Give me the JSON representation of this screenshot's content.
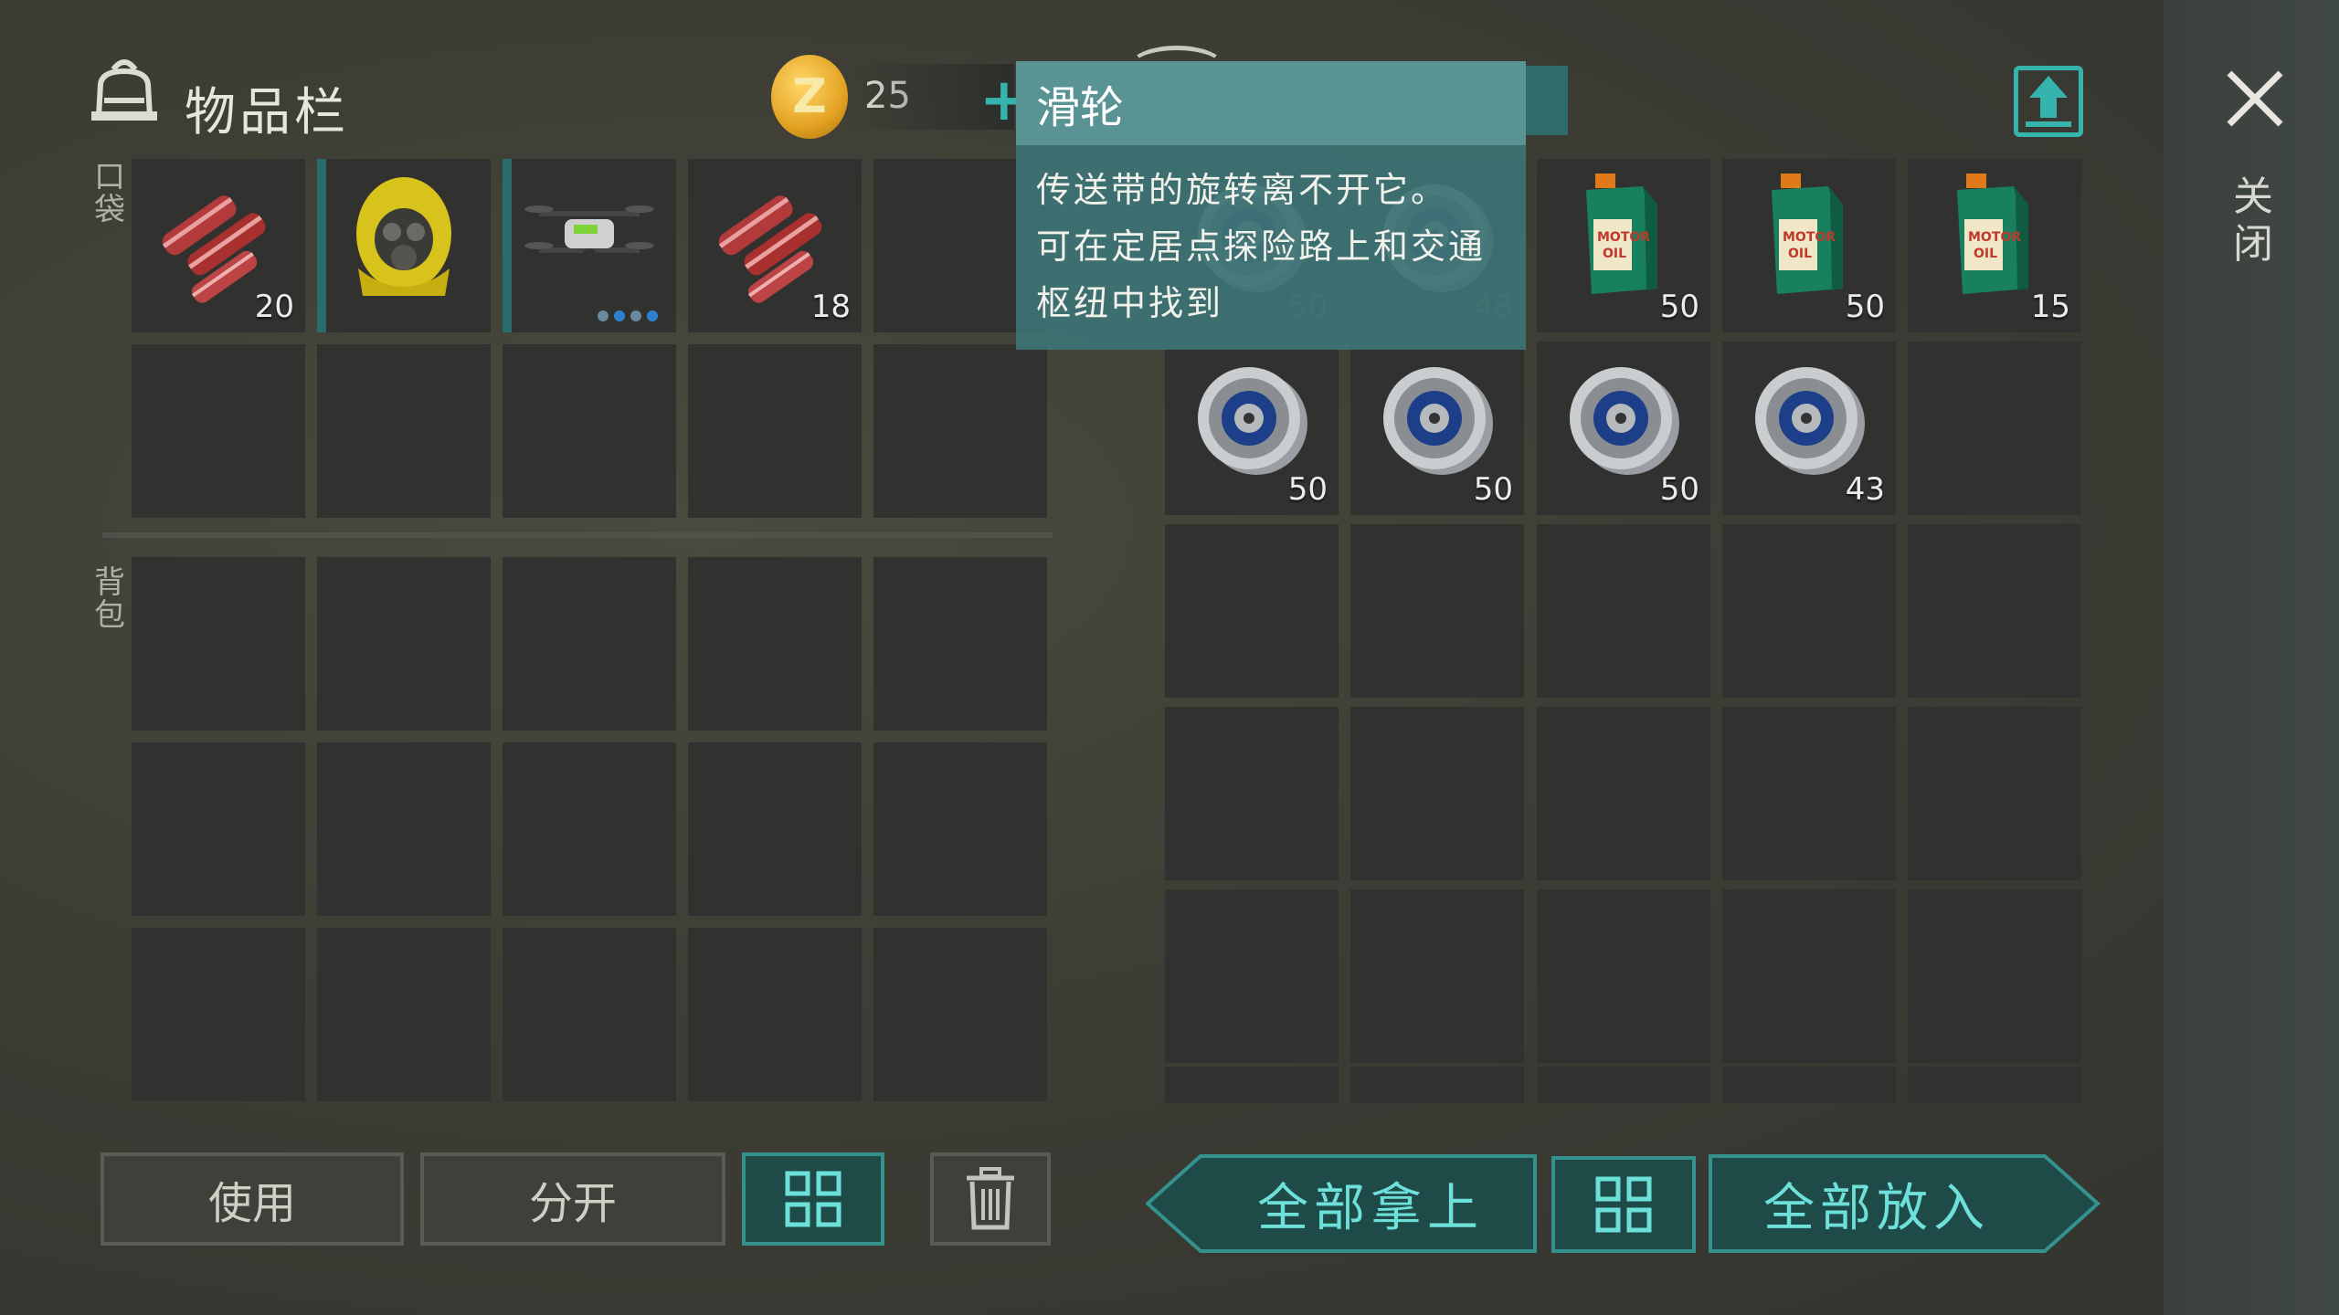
{
  "header": {
    "title": "物品栏",
    "coins": "25",
    "close_label": "关闭"
  },
  "sections": {
    "pockets": "口袋",
    "backpack": "背包"
  },
  "player_items": [
    {
      "icon": "bacon-icon",
      "count": "20"
    },
    {
      "icon": "hazmat-hood-icon",
      "count": ""
    },
    {
      "icon": "drone-icon",
      "count": ""
    },
    {
      "icon": "bacon-icon",
      "count": "18"
    }
  ],
  "container_row1": [
    {
      "icon": "pulley-icon",
      "count": "50"
    },
    {
      "icon": "pulley-icon",
      "count": "48"
    },
    {
      "icon": "motor-oil-icon",
      "count": "50"
    },
    {
      "icon": "motor-oil-icon",
      "count": "50"
    },
    {
      "icon": "motor-oil-icon",
      "count": "15"
    }
  ],
  "container_row2": [
    {
      "icon": "pulley-icon",
      "count": "50"
    },
    {
      "icon": "pulley-icon",
      "count": "50"
    },
    {
      "icon": "pulley-icon",
      "count": "50"
    },
    {
      "icon": "pulley-icon",
      "count": "43"
    }
  ],
  "oil_label": "MOTOR OIL",
  "tooltip": {
    "title": "滑轮",
    "lines": [
      "传送带的旋转离不开它。",
      "可在定居点探险路上和交通",
      "枢纽中找到"
    ]
  },
  "buttons": {
    "use": "使用",
    "split": "分开",
    "take_all": "全部拿上",
    "put_all": "全部放入"
  },
  "colors": {
    "accent": "#35918d",
    "slot": "#31322f",
    "tooltip": "#3e7374"
  }
}
